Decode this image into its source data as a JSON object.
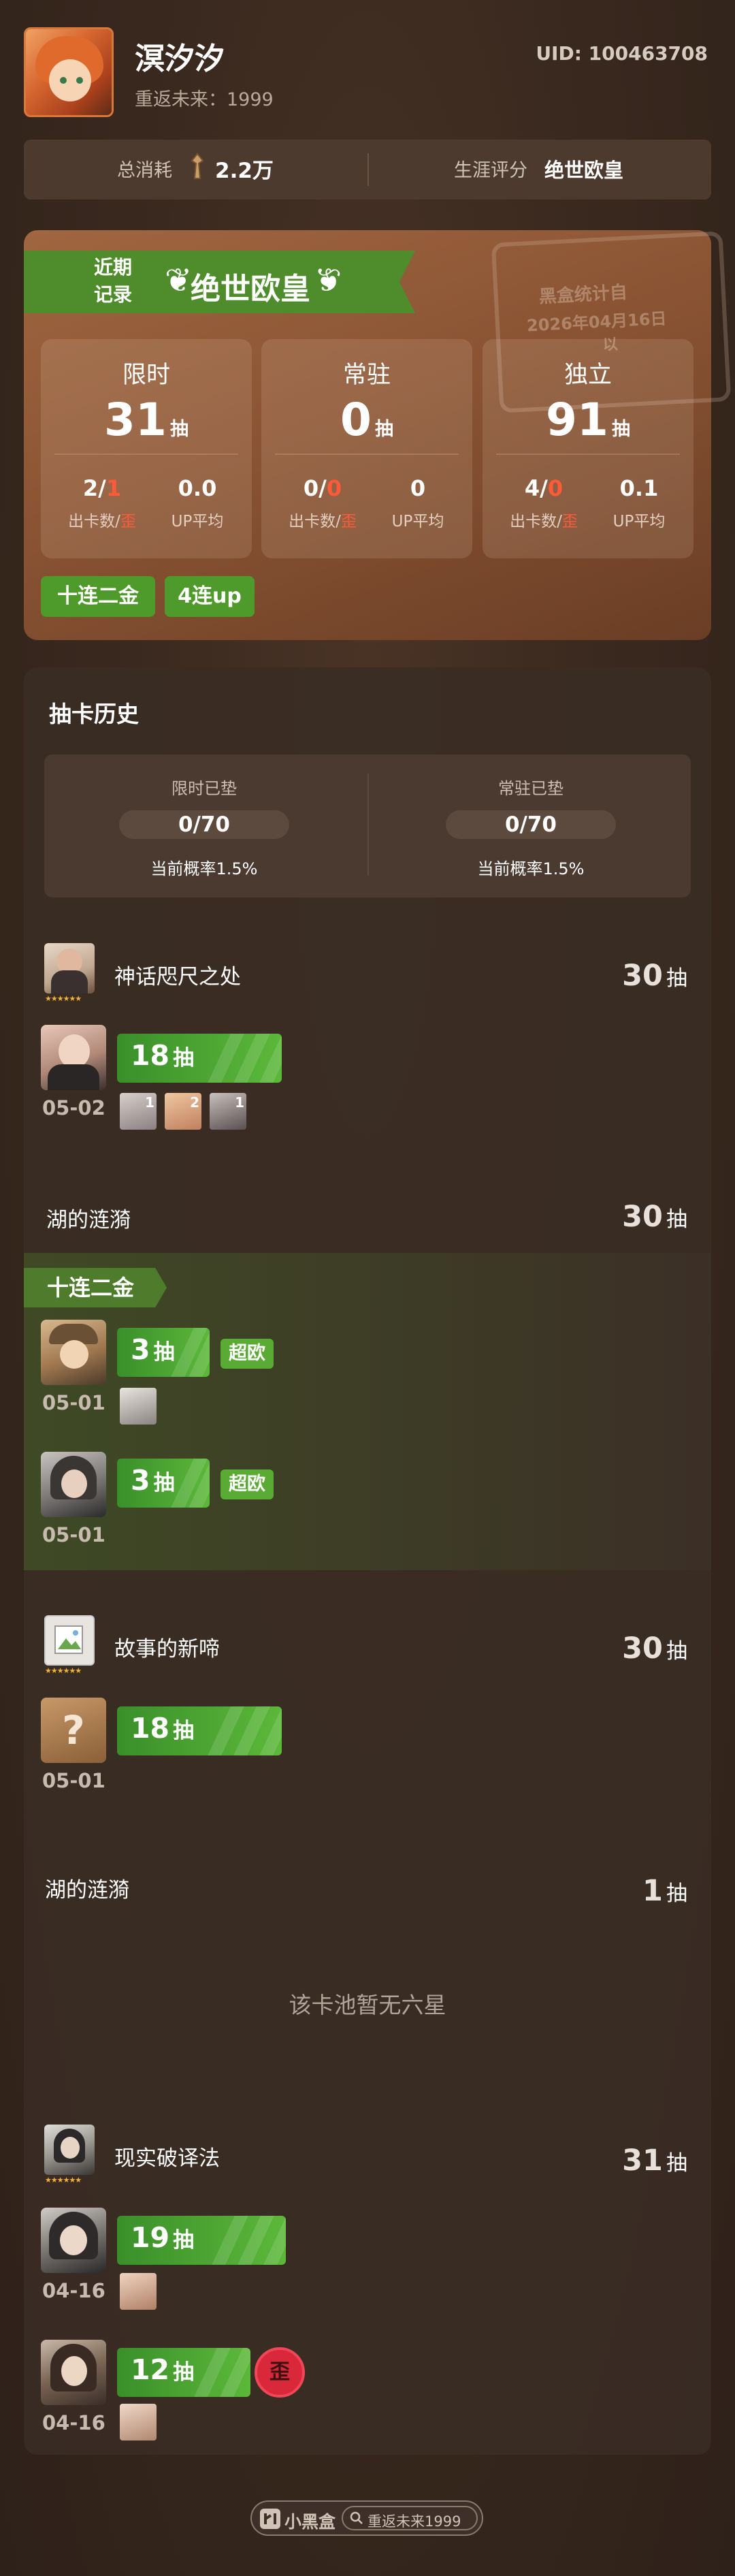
{
  "header": {
    "username": "溟汐汐",
    "server": "重返未来：1999",
    "uid": "UID: 100463708"
  },
  "stats": {
    "total_label": "总消耗",
    "total_value": "2.2万",
    "rating_label": "生涯评分",
    "rating_value": "绝世欧皇"
  },
  "recent": {
    "ribbon_small_1": "近期",
    "ribbon_small_2": "记录",
    "title": "绝世欧皇",
    "stamp_line1": "黑盒统计自",
    "stamp_line2": "2026年04月16日",
    "stamp_line3": "以",
    "modes": [
      {
        "title": "限时",
        "pulls": "31",
        "unit": "抽",
        "gold": "2",
        "off": "1",
        "up_avg": "0.0",
        "gold_label": "出卡数/",
        "off_label": "歪",
        "up_label": "UP平均"
      },
      {
        "title": "常驻",
        "pulls": "0",
        "unit": "抽",
        "gold": "0",
        "off": "0",
        "up_avg": "0",
        "gold_label": "出卡数/",
        "off_label": "歪",
        "up_label": "UP平均"
      },
      {
        "title": "独立",
        "pulls": "91",
        "unit": "抽",
        "gold": "4",
        "off": "0",
        "up_avg": "0.1",
        "gold_label": "出卡数/",
        "off_label": "歪",
        "up_label": "UP平均"
      }
    ],
    "tags": [
      "十连二金",
      "4连up"
    ]
  },
  "history": {
    "title": "抽卡历史",
    "pity": [
      {
        "label": "限时已垫",
        "value": "0/70",
        "rate": "当前概率1.5%"
      },
      {
        "label": "常驻已垫",
        "value": "0/70",
        "rate": "当前概率1.5%"
      }
    ],
    "pools": [
      {
        "name": "神话咫尺之处",
        "count": "30",
        "unit": "抽",
        "stars": "★★★★★★",
        "pulls": [
          {
            "num": "18",
            "unit": "抽",
            "date": "05-02",
            "minis": [
              "1",
              "2",
              "1"
            ]
          }
        ]
      },
      {
        "name": "湖的涟漪",
        "count": "30",
        "unit": "抽",
        "ribbon": "十连二金",
        "pulls": [
          {
            "num": "3",
            "unit": "抽",
            "date": "05-01",
            "badge": "超欧"
          },
          {
            "num": "3",
            "unit": "抽",
            "date": "05-01",
            "badge": "超欧"
          }
        ]
      },
      {
        "name": "故事的新啼",
        "count": "30",
        "unit": "抽",
        "stars": "★★★★★★",
        "pulls": [
          {
            "num": "18",
            "unit": "抽",
            "date": "05-01",
            "avatar": "?"
          }
        ]
      },
      {
        "name": "湖的涟漪",
        "count": "1",
        "unit": "抽",
        "empty": "该卡池暂无六星"
      },
      {
        "name": "现实破译法",
        "count": "31",
        "unit": "抽",
        "stars": "★★★★★★",
        "pulls": [
          {
            "num": "19",
            "unit": "抽",
            "date": "04-16"
          },
          {
            "num": "12",
            "unit": "抽",
            "date": "04-16",
            "off_badge": "歪"
          }
        ]
      }
    ]
  },
  "footer": {
    "logo": "小黑盒",
    "search": "重返未来1999"
  },
  "colors": {
    "accent_green": "#4e9a2a",
    "off_red": "#ff5a3a",
    "background": "#3a291f"
  }
}
